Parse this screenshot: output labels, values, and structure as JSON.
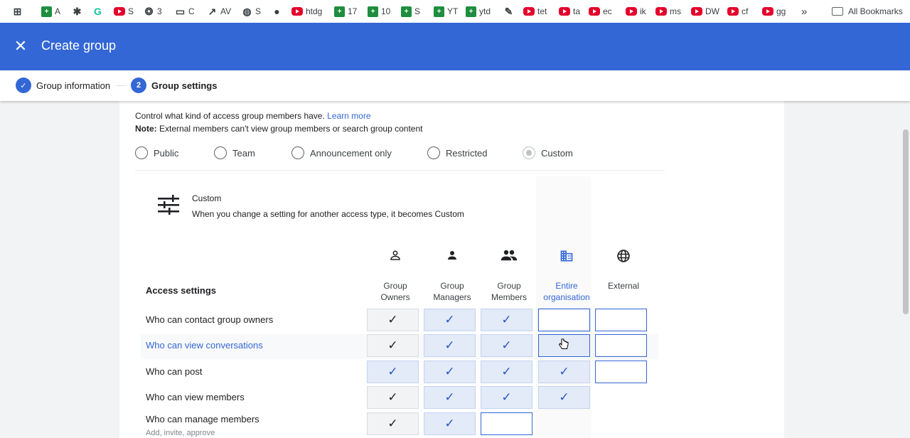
{
  "bookmarks": {
    "items": [
      {
        "icon": "apps-grid-icon",
        "label": ""
      },
      {
        "icon": "sheets-icon",
        "label": "A"
      },
      {
        "icon": "puzzle-icon",
        "label": ""
      },
      {
        "icon": "grammarly-icon",
        "label": ""
      },
      {
        "icon": "youtube-icon",
        "label": "S"
      },
      {
        "icon": "openai-icon",
        "label": "3"
      },
      {
        "icon": "folder-icon",
        "label": "C"
      },
      {
        "icon": "trend-icon",
        "label": "AV"
      },
      {
        "icon": "globe-icon",
        "label": "S"
      },
      {
        "icon": "github-icon",
        "label": ""
      },
      {
        "icon": "youtube-icon",
        "label": "htdg"
      },
      {
        "icon": "sheets-icon",
        "label": "17"
      },
      {
        "icon": "sheets-icon",
        "label": "10"
      },
      {
        "icon": "sheets-icon",
        "label": "S"
      },
      {
        "icon": "sheets-icon",
        "label": "YT"
      },
      {
        "icon": "sheets-icon",
        "label": "ytd"
      },
      {
        "icon": "pin-icon",
        "label": ""
      },
      {
        "icon": "youtube-icon",
        "label": "tet"
      },
      {
        "icon": "youtube-icon",
        "label": "ta"
      },
      {
        "icon": "youtube-icon",
        "label": "ec"
      },
      {
        "icon": "youtube-icon",
        "label": "ik"
      },
      {
        "icon": "youtube-icon",
        "label": "ms"
      },
      {
        "icon": "youtube-icon",
        "label": "DW"
      },
      {
        "icon": "youtube-icon",
        "label": "cf"
      },
      {
        "icon": "youtube-icon",
        "label": "gg"
      }
    ],
    "more": "»",
    "all_bookmarks": "All Bookmarks"
  },
  "header": {
    "close": "✕",
    "title": "Create group"
  },
  "stepper": {
    "step1": {
      "mark": "✓",
      "label": "Group information"
    },
    "step2": {
      "mark": "2",
      "label": "Group settings"
    }
  },
  "intro": {
    "line1": "Control what kind of access group members have.",
    "learn_more": "Learn more",
    "note_label": "Note:",
    "note_text": "External members can't view group members or search group content"
  },
  "access_types": {
    "options": [
      "Public",
      "Team",
      "Announcement only",
      "Restricted",
      "Custom"
    ],
    "selected": "Custom"
  },
  "custom": {
    "title": "Custom",
    "description": "When you change a setting for another access type, it becomes Custom"
  },
  "columns": [
    {
      "label": "Group\nOwners",
      "icon": "person-outline-icon"
    },
    {
      "label": "Group\nManagers",
      "icon": "person-icon"
    },
    {
      "label": "Group\nMembers",
      "icon": "group-icon"
    },
    {
      "label": "Entire\norganisation",
      "icon": "domain-icon"
    },
    {
      "label": "External",
      "icon": "globe-icon"
    }
  ],
  "access_settings": {
    "title": "Access settings",
    "rows": [
      {
        "label": "Who can contact group owners",
        "sub": "",
        "cells": [
          "check",
          "check",
          "check",
          "empty",
          "empty"
        ]
      },
      {
        "label": "Who can view conversations",
        "sub": "",
        "cells": [
          "check",
          "check",
          "check",
          "empty",
          "empty"
        ]
      },
      {
        "label": "Who can post",
        "sub": "",
        "cells": [
          "check",
          "check",
          "check",
          "check",
          "empty"
        ]
      },
      {
        "label": "Who can view members",
        "sub": "",
        "cells": [
          "check",
          "check",
          "check",
          "check",
          ""
        ]
      },
      {
        "label": "Who can manage members",
        "sub": "Add, invite, approve",
        "cells": [
          "check",
          "check",
          "empty",
          "",
          ""
        ]
      }
    ]
  },
  "check_glyph": "✓",
  "colors": {
    "header": "#3367d6",
    "accent": "#3367d6",
    "cell_blue": "#e3eaf8",
    "cell_grey": "#f1f3f4"
  }
}
